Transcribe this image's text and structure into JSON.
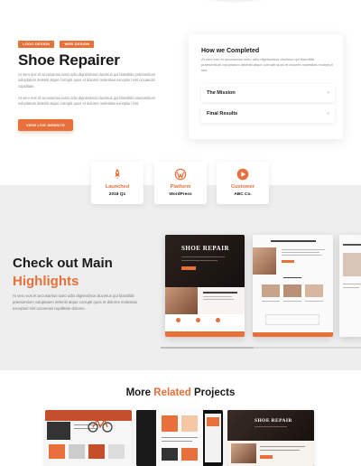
{
  "hero": {
    "tags": [
      "LOGO DESIGN",
      "WEB DESIGN"
    ],
    "title": "Shoe Repairer",
    "paragraph1": "At vero eos et accusamus iusto odio dignissimos ducimus qui blanditiis praesentium voluptatum deleniti atque corrupti quos et dolores molestias excepturi sint occaecati cupiditate.",
    "paragraph2": "At vero eos et accusamus iusto odio dignissimos ducimus qui blanditiis praesentium voluptatum deleniti atque corrupti quos et dolores molestias excepturi sint.",
    "button_label": "VIEW LIVE WEBSITE"
  },
  "completed": {
    "title": "How we Completed",
    "paragraph": "At vero eos et accusamus iusto odio dignissimos ducimus qui blanditiis praesentium voluptatum deleniti atque corrupti quos et dolores molestias excepturi sint.",
    "items": [
      {
        "label": "The Mission",
        "icon": "plus-icon"
      },
      {
        "label": "Final Results",
        "icon": "plus-icon"
      }
    ]
  },
  "stats": [
    {
      "label": "Launched",
      "value": "2018 Q1",
      "icon": "rocket-icon"
    },
    {
      "label": "Platform",
      "value": "WordPress",
      "icon": "wordpress-icon"
    },
    {
      "label": "Customer",
      "value": "ABC Co.",
      "icon": "customer-logo-icon"
    }
  ],
  "highlights": {
    "title_line1": "Check out Main",
    "title_line2": "Highlights",
    "paragraph": "At vero eos et accusamus iusto odio dignissimos ducimus qui blanditiis praesentium voluptatum deleniti atque corrupti quos et dolores molestias excepturi sint occaecati cupiditate dolores.",
    "screenshot_brand": "SHOE REPAIR"
  },
  "related": {
    "title_prefix": "More",
    "title_accent": "Related",
    "title_suffix": "Projects",
    "thumb_brand": "SHOE REPAIR"
  },
  "colors": {
    "accent": "#e8703a",
    "band": "#eeeeee",
    "text": "#1a1a1a"
  }
}
